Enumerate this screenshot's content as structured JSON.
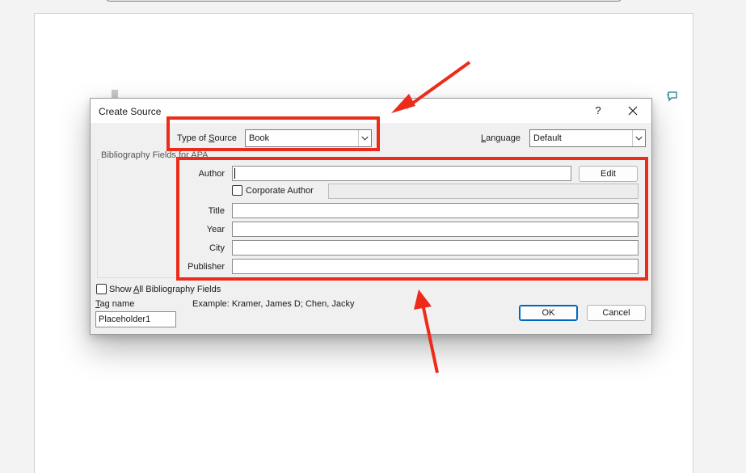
{
  "dialog": {
    "title": "Create Source",
    "help_label": "?",
    "type_of_source_label": "Type of ",
    "type_of_source_label_u": "S",
    "type_of_source_label_rest": "ource",
    "type_of_source_value": "Book",
    "language_label_u": "L",
    "language_label_rest": "anguage",
    "language_value": "Default",
    "group_label": "Bibliography Fields for APA",
    "fields": {
      "author": {
        "label": "Author",
        "value": ""
      },
      "corporate_author": {
        "label": "Corporate Author"
      },
      "title": {
        "label": "Title",
        "value": ""
      },
      "year": {
        "label": "Year",
        "value": ""
      },
      "city": {
        "label": "City",
        "value": ""
      },
      "publisher": {
        "label": "Publisher",
        "value": ""
      }
    },
    "edit_button": "Edit",
    "show_all_label_pre": "Show ",
    "show_all_label_u": "A",
    "show_all_label_rest": "ll Bibliography Fields",
    "tag_name_label_u": "T",
    "tag_name_label_rest": "ag name",
    "tag_name_value": "Placeholder1",
    "example_text": "Example: Kramer, James D; Chen, Jacky",
    "ok_button": "OK",
    "cancel_button": "Cancel"
  },
  "colors": {
    "annotation_red": "#ec2b1a",
    "primary_blue": "#0067c0"
  },
  "icons": {
    "close": "close-icon",
    "dropdown": "chevron-down-icon",
    "comment": "comment-icon"
  }
}
